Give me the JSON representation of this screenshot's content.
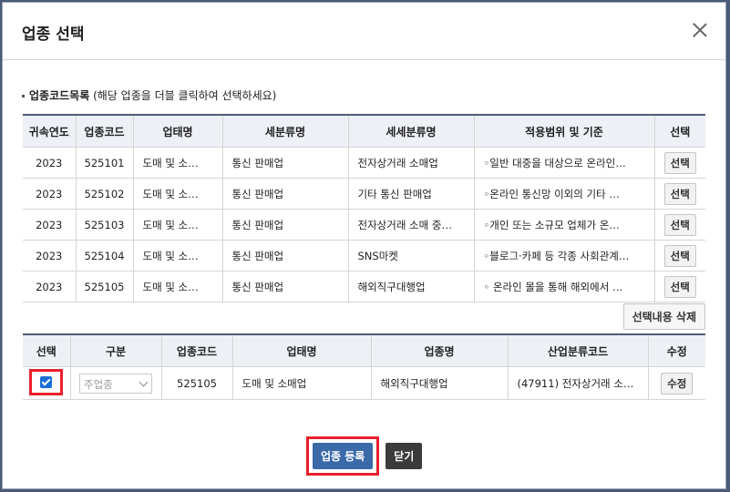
{
  "modal": {
    "title": "업종 선택"
  },
  "section": {
    "title": "업종코드목록",
    "hint": "(해당 업종을 더블 클릭하여 선택하세요)"
  },
  "list_table": {
    "headers": [
      "귀속연도",
      "업종코드",
      "업태명",
      "세분류명",
      "세세분류명",
      "적용범위 및 기준",
      "선택"
    ],
    "rows": [
      {
        "year": "2023",
        "code": "525101",
        "business": "도매 및 소…",
        "sub": "통신 판매업",
        "subsub": "전자상거래 소매업",
        "scope": "◦일반 대중을 대상으로 온라인…",
        "button": "선택"
      },
      {
        "year": "2023",
        "code": "525102",
        "business": "도매 및 소…",
        "sub": "통신 판매업",
        "subsub": "기타 통신 판매업",
        "scope": "◦온라인 통신망 이외의 기타 …",
        "button": "선택"
      },
      {
        "year": "2023",
        "code": "525103",
        "business": "도매 및 소…",
        "sub": "통신 판매업",
        "subsub": "전자상거래 소매 중…",
        "scope": "◦개인 또는 소규모 업체가 온…",
        "button": "선택"
      },
      {
        "year": "2023",
        "code": "525104",
        "business": "도매 및 소…",
        "sub": "통신 판매업",
        "subsub": "SNS마켓",
        "scope": "◦블로그·카페 등 각종 사회관계…",
        "button": "선택"
      },
      {
        "year": "2023",
        "code": "525105",
        "business": "도매 및 소…",
        "sub": "통신 판매업",
        "subsub": "해외직구대행업",
        "scope": "◦ 온라인 몰을 통해 해외에서 …",
        "button": "선택"
      }
    ]
  },
  "delete_button": "선택내용 삭제",
  "selected_table": {
    "headers": [
      "선택",
      "구분",
      "업종코드",
      "업태명",
      "업종명",
      "산업분류코드",
      "수정"
    ],
    "row": {
      "checked": true,
      "type_value": "주업종",
      "code": "525105",
      "business": "도매 및 소매업",
      "industry": "해외직구대행업",
      "class_code": "(47911) 전자상거래 소…",
      "button": "수정"
    }
  },
  "footer": {
    "register": "업종 등록",
    "close": "닫기"
  },
  "colors": {
    "header_bg": "#edf0f5",
    "primary": "#3a6aa8",
    "highlight": "#e8202a",
    "dark_button": "#3b3b3b"
  }
}
